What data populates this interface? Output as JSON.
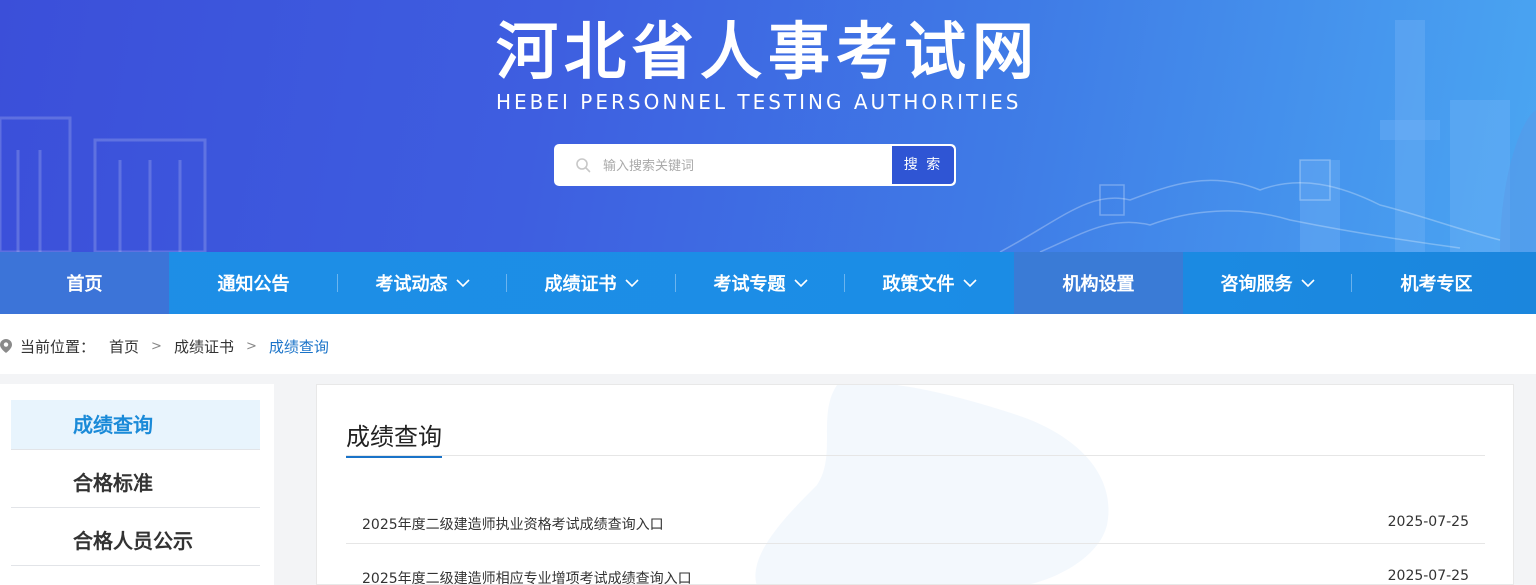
{
  "header": {
    "title": "河北省人事考试网",
    "subtitle": "HEBEI PERSONNEL TESTING AUTHORITIES",
    "search": {
      "placeholder": "输入搜索关键词",
      "button_label": "搜 索"
    }
  },
  "nav": {
    "items": [
      {
        "label": "首页",
        "has_dropdown": false
      },
      {
        "label": "通知公告",
        "has_dropdown": false
      },
      {
        "label": "考试动态",
        "has_dropdown": true
      },
      {
        "label": "成绩证书",
        "has_dropdown": true
      },
      {
        "label": "考试专题",
        "has_dropdown": true
      },
      {
        "label": "政策文件",
        "has_dropdown": true
      },
      {
        "label": "机构设置",
        "has_dropdown": false
      },
      {
        "label": "咨询服务",
        "has_dropdown": true
      },
      {
        "label": "机考专区",
        "has_dropdown": false
      }
    ]
  },
  "breadcrumb": {
    "prefix": "当前位置：",
    "items": [
      "首页",
      "成绩证书",
      "成绩查询"
    ],
    "separator": ">"
  },
  "sidebar": {
    "items": [
      {
        "label": "成绩查询",
        "active": true
      },
      {
        "label": "合格标准",
        "active": false
      },
      {
        "label": "合格人员公示",
        "active": false
      }
    ]
  },
  "main": {
    "title": "成绩查询",
    "list": [
      {
        "title": "2025年度二级建造师执业资格考试成绩查询入口",
        "date": "2025-07-25"
      },
      {
        "title": "2025年度二级建造师相应专业增项考试成绩查询入口",
        "date": "2025-07-25"
      }
    ]
  },
  "colors": {
    "banner_start": "#3b4fd9",
    "banner_end": "#4aa6f2",
    "nav_bg": "#1e8ee6",
    "accent": "#1a73c8",
    "sidebar_active_bg": "#e8f4fd",
    "sidebar_active_text": "#1a8ad8"
  }
}
